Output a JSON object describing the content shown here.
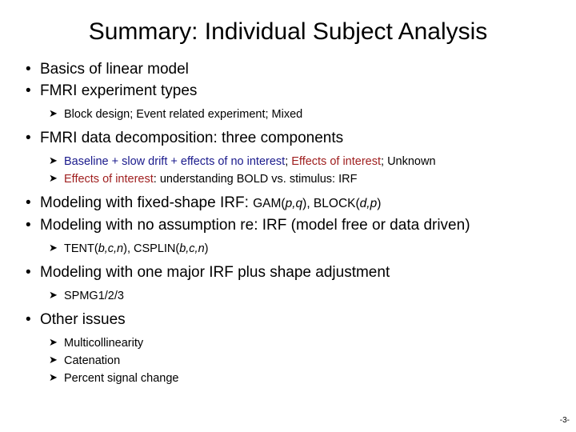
{
  "slide": {
    "title": "Summary: Individual Subject Analysis",
    "page_number": "-3-",
    "colors": {
      "text": "#000000",
      "blue": "#1a1a8c",
      "red": "#a02020",
      "background": "#ffffff"
    },
    "bullet_glyph": "•",
    "subbullet_glyph": "➤",
    "items": [
      {
        "level": 1,
        "text": "Basics of linear model"
      },
      {
        "level": 1,
        "text": "FMRI experiment types"
      },
      {
        "level": 2,
        "text": "Block design; Event related experiment; Mixed"
      },
      {
        "level": 1,
        "text": "FMRI data decomposition: three components"
      },
      {
        "level": 2,
        "runs": [
          {
            "text": "Baseline + slow drift + effects of no interest",
            "color": "blue"
          },
          {
            "text": "; ",
            "color": "black"
          },
          {
            "text": "Effects of interest",
            "color": "red"
          },
          {
            "text": "; Unknown",
            "color": "black"
          }
        ]
      },
      {
        "level": 2,
        "runs": [
          {
            "text": "Effects of interest",
            "color": "red"
          },
          {
            "text": ": understanding BOLD vs. stimulus: IRF",
            "color": "black"
          }
        ]
      },
      {
        "level": 1,
        "runs": [
          {
            "text": "Modeling with fixed-shape IRF: ",
            "color": "black"
          },
          {
            "text": "GAM(",
            "color": "black",
            "style": "code"
          },
          {
            "text": "p,q",
            "color": "black",
            "style": "code-italic"
          },
          {
            "text": "), BLOCK(",
            "color": "black",
            "style": "code"
          },
          {
            "text": "d,p",
            "color": "black",
            "style": "code-italic"
          },
          {
            "text": ")",
            "color": "black",
            "style": "code"
          }
        ]
      },
      {
        "level": 1,
        "text": "Modeling with no assumption re: IRF (model free or data driven)"
      },
      {
        "level": 2,
        "runs": [
          {
            "text": "TENT(",
            "color": "black"
          },
          {
            "text": "b,c,n",
            "color": "black",
            "style": "italic"
          },
          {
            "text": "), CSPLIN(",
            "color": "black"
          },
          {
            "text": "b,c,n",
            "color": "black",
            "style": "italic"
          },
          {
            "text": ")",
            "color": "black"
          }
        ]
      },
      {
        "level": 1,
        "text": "Modeling with one major IRF plus shape adjustment"
      },
      {
        "level": 2,
        "text": "SPMG1/2/3"
      },
      {
        "level": 1,
        "text": "Other issues"
      },
      {
        "level": 2,
        "text": "Multicollinearity"
      },
      {
        "level": 2,
        "text": "Catenation"
      },
      {
        "level": 2,
        "text": "Percent signal change"
      }
    ],
    "lines": {
      "basics_of_linear_model": "Basics of linear model",
      "fmri_experiment_types": "FMRI experiment types",
      "block_design": "Block design; Event related experiment; Mixed",
      "fmri_data_decomposition": "FMRI data decomposition: three components",
      "decomp_run_1": "Baseline + slow drift + effects of no interest",
      "decomp_run_2": "; ",
      "decomp_run_3": "Effects of interest",
      "decomp_run_4": "; Unknown",
      "eoi_run_1": "Effects of interest",
      "eoi_run_2": ": understanding BOLD vs. stimulus: IRF",
      "fixed_shape_prefix": "Modeling with fixed-shape IRF: ",
      "gam_open": "GAM(",
      "gam_params": "p,q",
      "gam_close_block_open": "), BLOCK(",
      "block_params": "d,p",
      "block_close": ")",
      "no_assumption": "Modeling with no assumption re: IRF (model free or data driven)",
      "tent_open": "TENT(",
      "tent_params": "b,c,n",
      "tent_close_csplin_open": "), CSPLIN(",
      "csplin_params": "b,c,n",
      "csplin_close": ")",
      "one_major_irf": "Modeling with one major IRF plus shape adjustment",
      "spmg": "SPMG1/2/3",
      "other_issues": "Other issues",
      "multicollinearity": "Multicollinearity",
      "catenation": "Catenation",
      "percent_signal_change": "Percent signal change"
    }
  }
}
